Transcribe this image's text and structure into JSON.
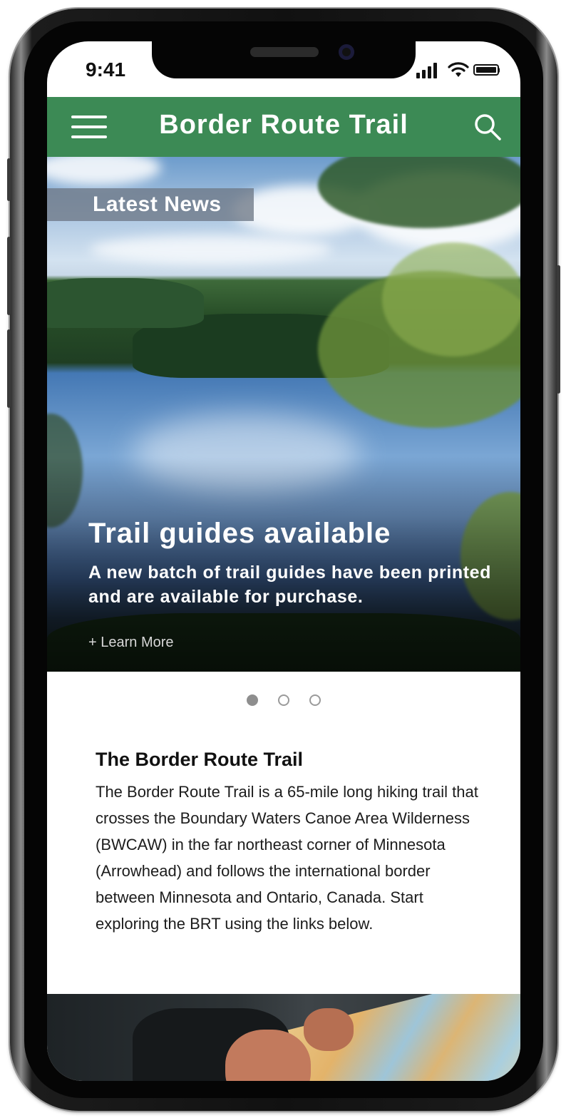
{
  "status_bar": {
    "time": "9:41",
    "icons": [
      "cellular-signal-icon",
      "wifi-icon",
      "battery-icon"
    ]
  },
  "header": {
    "title": "Border Route Trail",
    "menu_icon": "hamburger-menu-icon",
    "search_icon": "search-icon",
    "background_color": "#3c8a55"
  },
  "carousel": {
    "tag": "Latest News",
    "slide": {
      "title": "Trail guides available",
      "body": "A new batch of trail guides have been printed and are available for purchase.",
      "link": "+ Learn More"
    },
    "dots_total": 3,
    "active_index": 0
  },
  "intro": {
    "heading": "The Border Route Trail",
    "body": "The Border Route Trail is a 65-mile long hiking trail that crosses the Boundary Waters Canoe Area Wilderness (BWCAW) in the far northeast corner of Minnesota (Arrowhead) and follows the international border between Minnesota and Ontario, Canada. Start exploring the BRT using the links below."
  }
}
